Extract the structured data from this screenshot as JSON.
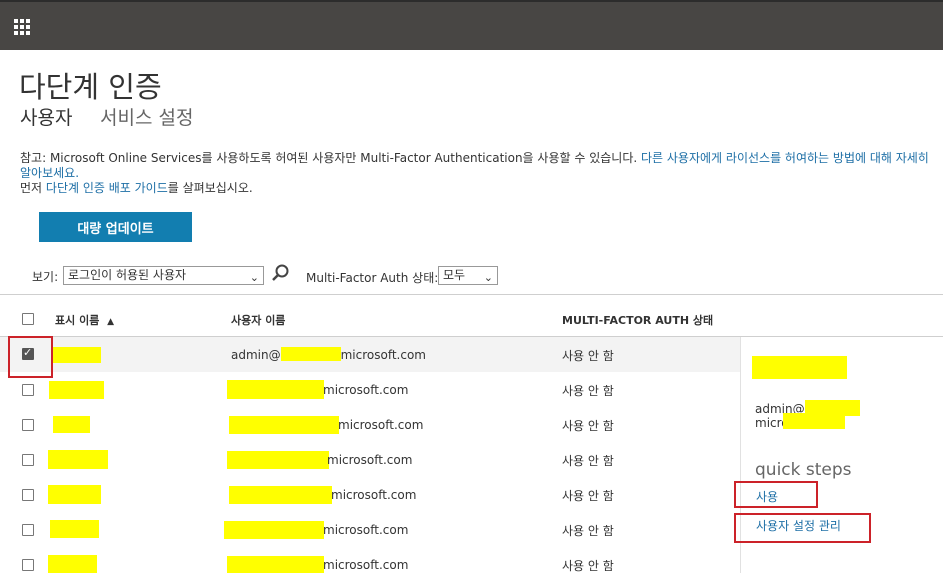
{
  "page": {
    "title": "다단계 인증"
  },
  "tabs": [
    {
      "label": "사용자"
    },
    {
      "label": "서비스 설정"
    }
  ],
  "note": {
    "prefix": "참고: Microsoft Online Services를 사용하도록 허여된 사용자만 Multi-Factor Authentication을 사용할 수 있습니다. ",
    "link1": "다른 사용자에게 라이선스를 허여하는 방법에 대해 자세히 알아보세요.",
    "line2_prefix": "먼저 ",
    "link2": "다단계 인증 배포 가이드",
    "line2_suffix": "를 살펴보십시오."
  },
  "toolbar": {
    "bulk_update": "대량 업데이트"
  },
  "filters": {
    "view_label": "보기:",
    "view_value": "로그인이 허용된 사용자",
    "mfa_label": "Multi-Factor Auth 상태:",
    "mfa_value": "모두"
  },
  "table": {
    "headers": {
      "display_name": "표시 이름",
      "sort_arrow": "▲",
      "user_name": "사용자 이름",
      "mfa_status": "MULTI-FACTOR AUTH 상태"
    },
    "rows": [
      {
        "user_prefix": "admin@",
        "user_suffix": "microsoft.com",
        "status": "사용 안 함",
        "checked": true
      },
      {
        "user_prefix": "",
        "user_suffix": "microsoft.com",
        "status": "사용 안 함",
        "checked": false
      },
      {
        "user_prefix": "",
        "user_suffix": "microsoft.com",
        "status": "사용 안 함",
        "checked": false
      },
      {
        "user_prefix": "",
        "user_suffix": "microsoft.com",
        "status": "사용 안 함",
        "checked": false
      },
      {
        "user_prefix": "",
        "user_suffix": "microsoft.com",
        "status": "사용 안 함",
        "checked": false
      },
      {
        "user_prefix": "",
        "user_suffix": "microsoft.com",
        "status": "사용 안 함",
        "checked": false
      },
      {
        "user_prefix": "",
        "user_suffix": "microsoft.com",
        "status": "사용 안 함",
        "checked": false
      }
    ]
  },
  "panel": {
    "email_prefix": "admin@",
    "email_suffix": "microsoft.com",
    "quick_steps": "quick steps",
    "enable": "사용",
    "manage_settings": "사용자 설정 관리"
  },
  "colors": {
    "topbar": "#484644",
    "accent": "#127eb0",
    "link": "#1e6fa6",
    "highlight_box": "#cc2229",
    "redaction": "#ffff00"
  },
  "icons": {
    "app_launcher": "waffle-icon",
    "search": "search-icon",
    "dropdown": "chevron-down-icon"
  }
}
